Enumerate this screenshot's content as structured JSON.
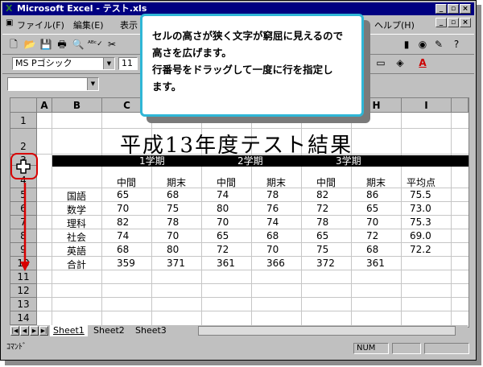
{
  "window": {
    "title": "Microsoft Excel - テスト.xls"
  },
  "menu": {
    "file": "ファイル(F)",
    "edit": "編集(E)",
    "view": "表示",
    "help": "ヘルプ(H)"
  },
  "format": {
    "font": "MS Pゴシック",
    "size": "11"
  },
  "columns": [
    "A",
    "B",
    "C",
    "D",
    "E",
    "F",
    "G",
    "H",
    "I"
  ],
  "rows": [
    "1",
    "2",
    "3",
    "4",
    "5",
    "6",
    "7",
    "8",
    "9",
    "10",
    "11",
    "12",
    "13",
    "14"
  ],
  "sheet": {
    "title": "平成13年度テスト結果",
    "terms": [
      "1学期",
      "2学期",
      "3学期"
    ],
    "headers": [
      "中間",
      "期末",
      "中間",
      "期末",
      "中間",
      "期末",
      "平均点"
    ],
    "data": [
      {
        "subject": "国語",
        "scores": [
          "65",
          "68",
          "74",
          "78",
          "82",
          "86"
        ],
        "avg": "75.5"
      },
      {
        "subject": "数学",
        "scores": [
          "70",
          "75",
          "80",
          "76",
          "72",
          "65"
        ],
        "avg": "73.0"
      },
      {
        "subject": "理科",
        "scores": [
          "82",
          "78",
          "70",
          "74",
          "78",
          "70"
        ],
        "avg": "75.3"
      },
      {
        "subject": "社会",
        "scores": [
          "74",
          "70",
          "65",
          "68",
          "65",
          "72"
        ],
        "avg": "69.0"
      },
      {
        "subject": "英語",
        "scores": [
          "68",
          "80",
          "72",
          "70",
          "75",
          "68"
        ],
        "avg": "72.2"
      }
    ],
    "total": {
      "label": "合計",
      "scores": [
        "359",
        "371",
        "361",
        "366",
        "372",
        "361"
      ]
    }
  },
  "tabs": [
    "Sheet1",
    "Sheet2",
    "Sheet3"
  ],
  "status": {
    "mode": "ｺﾏﾝﾄﾞ",
    "num": "NUM"
  },
  "callout": {
    "line1": "セルの高さが狭く文字が窮屈に見えるので",
    "line2": "高さを広げます。",
    "line3": "行番号をドラッグして一度に行を指定し",
    "line4": "ます。"
  },
  "colors": {
    "callout_border": "#2fb6d6",
    "highlight": "#d80000",
    "titlebar": "#000080"
  }
}
